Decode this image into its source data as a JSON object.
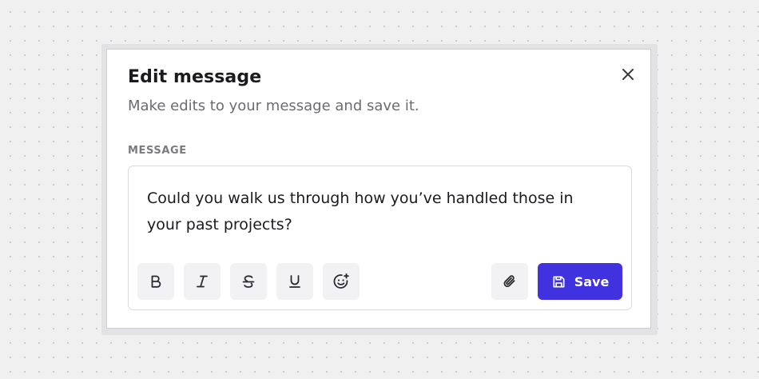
{
  "dialog": {
    "title": "Edit message",
    "subtitle": "Make edits to your message and save it.",
    "close_icon": "close-icon"
  },
  "field": {
    "label": "MESSAGE",
    "value": "Could you walk us through how you’ve handled those in your past projects?"
  },
  "toolbar": {
    "formatting": [
      {
        "name": "bold",
        "icon": "bold-icon"
      },
      {
        "name": "italic",
        "icon": "italic-icon"
      },
      {
        "name": "strikethrough",
        "icon": "strikethrough-icon"
      },
      {
        "name": "underline",
        "icon": "underline-icon"
      },
      {
        "name": "emoji",
        "icon": "emoji-add-icon"
      }
    ],
    "attach_icon": "paperclip-icon",
    "save_icon": "floppy-disk-icon",
    "save_label": "Save"
  },
  "colors": {
    "accent": "#4132e0",
    "title_text": "#1b1b1f",
    "muted_text": "#6b6b72",
    "button_bg": "#f2f2f4",
    "background": "#f0f0f1"
  }
}
